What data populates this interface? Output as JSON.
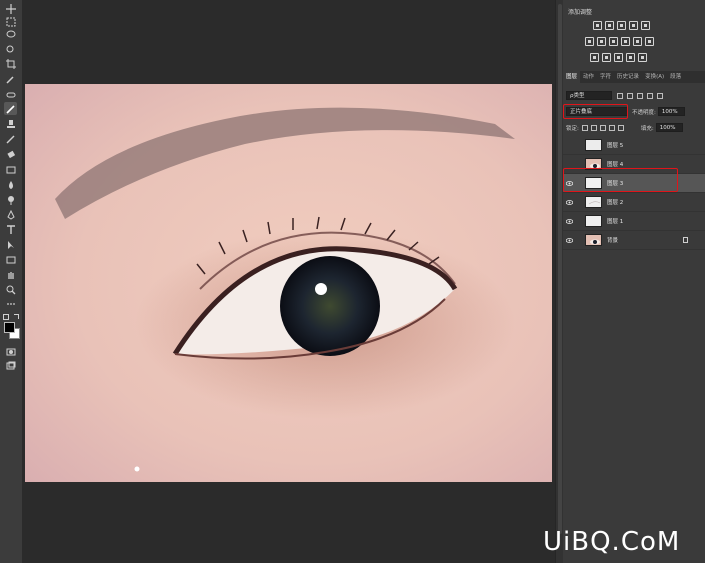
{
  "adjustments": {
    "title": "添加调整"
  },
  "tabs": [
    "图层",
    "动作",
    "字符",
    "历史记录",
    "变换(A)",
    "段落"
  ],
  "layer_controls": {
    "filter": "ρ类型",
    "blend_mode": "正片叠底",
    "opacity_label": "不透明度:",
    "opacity_value": "100%",
    "lock_label": "锁定:",
    "fill_label": "填充:",
    "fill_value": "100%"
  },
  "layers": [
    {
      "name": "图层 5",
      "visible": false,
      "thumb": "white"
    },
    {
      "name": "图层 4",
      "visible": false,
      "thumb": "photo"
    },
    {
      "name": "图层 3",
      "visible": true,
      "thumb": "white"
    },
    {
      "name": "图层 2",
      "visible": true,
      "thumb": "sketch"
    },
    {
      "name": "图层 1",
      "visible": true,
      "thumb": "white"
    },
    {
      "name": "背景",
      "visible": true,
      "thumb": "photo"
    }
  ],
  "watermark": "UiBQ.CoM",
  "colors": {
    "highlight": "#e0151a",
    "panel": "#3a3a3a",
    "selected_row": "#565656"
  }
}
